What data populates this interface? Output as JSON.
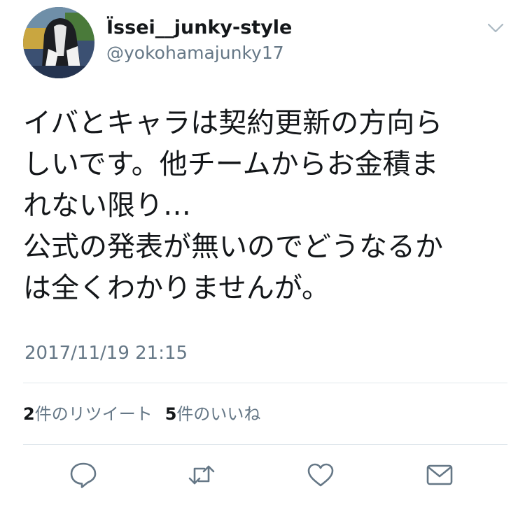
{
  "tweet": {
    "display_name": "Ïssei__junky-style",
    "username": "@yokohamajunky17",
    "text_lines": [
      "イバとキャラは契約更新の方向ら",
      "しいです。他チームからお金積ま",
      "れない限り…",
      "公式の発表が無いのでどうなるか",
      "は全くわかりませんが。"
    ],
    "timestamp": "2017/11/19 21:15"
  },
  "stats": {
    "retweet_count": "2",
    "retweet_label": "件のリツイート",
    "like_count": "5",
    "like_label": "件のいいね"
  },
  "icons": {
    "caret": "chevron-down-icon",
    "reply": "reply-icon",
    "retweet": "retweet-icon",
    "like": "heart-icon",
    "dm": "envelope-icon"
  },
  "colors": {
    "text": "#14171a",
    "secondary": "#657786",
    "icon": "#657786",
    "divider": "#e1e8ed"
  }
}
